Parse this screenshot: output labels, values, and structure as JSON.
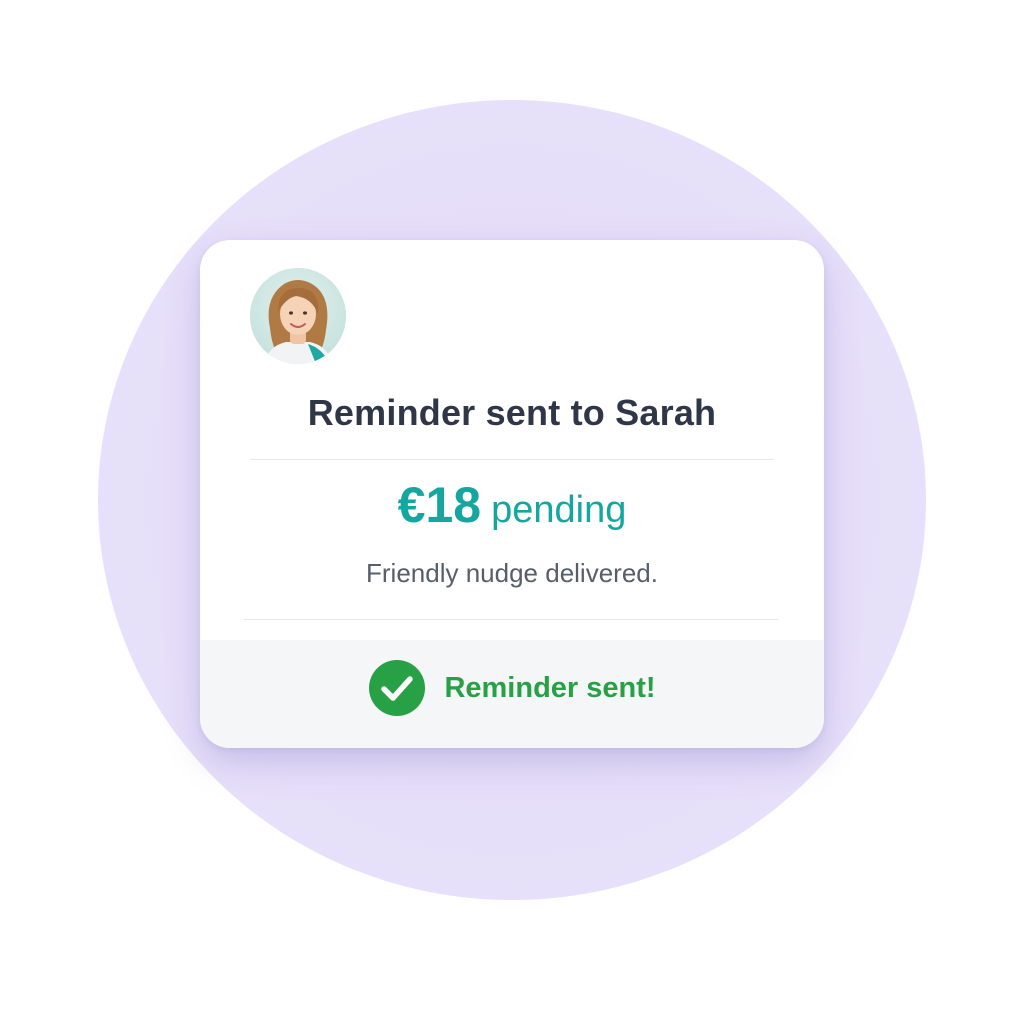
{
  "notification": {
    "title": "Reminder sent to Sarah",
    "amount": "€18",
    "amount_status": "pending",
    "message": "Friendly nudge delivered.",
    "status_text": "Reminder sent!",
    "avatar_icon": "person-photo-avatar",
    "status_icon": "check-circle-icon"
  },
  "colors": {
    "background_circle": "#e5ddf9",
    "title": "#2f3647",
    "accent_teal": "#16a6a0",
    "subtext": "#565d6b",
    "success_green": "#27a046",
    "footer_bg": "#f5f6f8"
  }
}
